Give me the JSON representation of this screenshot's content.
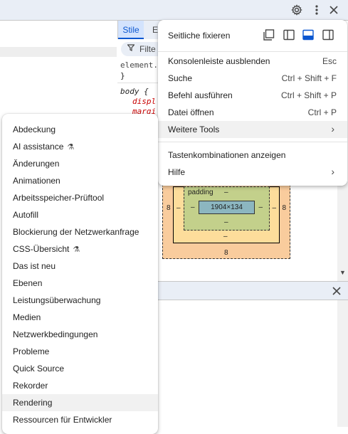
{
  "toolbar": {
    "settings_icon": "gear-icon",
    "more_icon": "vertical-dots-icon",
    "close_icon": "close-icon"
  },
  "styles_pane": {
    "tab_stile": "Stile",
    "tab_partial": "E",
    "filter_label": "Filte",
    "element_style": "element.",
    "brace_close": "}",
    "body_selector": "body {",
    "prop_display": "displ",
    "prop_margin": "margi"
  },
  "box_model": {
    "padding_label": "padding",
    "content_size": "1904×134",
    "margin_left": "8",
    "margin_right": "8",
    "margin_bottom": "8",
    "dash": "–"
  },
  "main_menu": {
    "dock_label": "Seitliche fixieren",
    "items": [
      {
        "label": "Konsolenleiste ausblenden",
        "shortcut": "Esc"
      },
      {
        "label": "Suche",
        "shortcut": "Ctrl + Shift + F"
      },
      {
        "label": "Befehl ausführen",
        "shortcut": "Ctrl + Shift + P"
      },
      {
        "label": "Datei öffnen",
        "shortcut": "Ctrl + P"
      },
      {
        "label": "Weitere Tools",
        "shortcut": ""
      }
    ],
    "items2": [
      {
        "label": "Tastenkombinationen anzeigen"
      },
      {
        "label": "Hilfe"
      }
    ]
  },
  "more_tools": {
    "items": [
      "Abdeckung",
      "AI assistance",
      "Änderungen",
      "Animationen",
      "Arbeitsspeicher-Prüftool",
      "Autofill",
      "Blockierung der Netzwerkanfrage",
      "CSS-Übersicht",
      "Das ist neu",
      "Ebenen",
      "Leistungsüberwachung",
      "Medien",
      "Netzwerkbedingungen",
      "Probleme",
      "Quick Source",
      "Rekorder",
      "Rendering",
      "Ressourcen für Entwickler"
    ],
    "highlighted": "Rendering"
  },
  "colors": {
    "accent": "#0b57d0",
    "menu_hover": "#f1f1f1",
    "margin_box": "#f9cc9d",
    "border_box": "#fddd9b",
    "padding_box": "#c3d08b",
    "content_box": "#8cb6c0"
  }
}
